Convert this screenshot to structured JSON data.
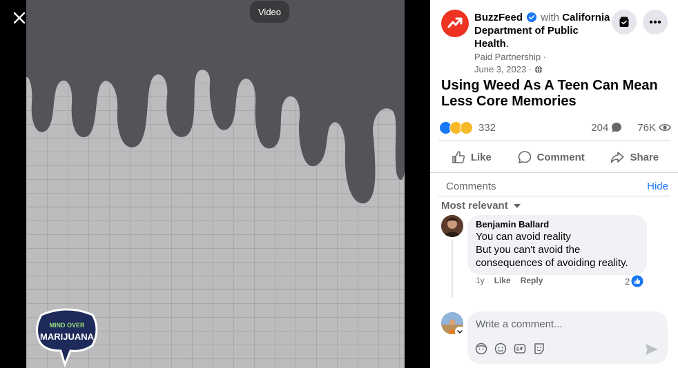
{
  "video": {
    "pill_label": "Video",
    "logo_line1": "MIND OVER",
    "logo_line2": "MARIJUANA"
  },
  "post": {
    "page_name": "BuzzFeed",
    "with_text": "with",
    "partner_name": "California Department of Public Health",
    "partner_suffix": ".",
    "partnership": "Paid Partnership ·",
    "date": "June 3, 2023 ·",
    "title": "Using Weed As A Teen Can Mean Less Core Memories",
    "reaction_count": "332",
    "comment_count": "204",
    "view_count": "76K"
  },
  "actions": {
    "like": "Like",
    "comment": "Comment",
    "share": "Share"
  },
  "comments": {
    "header": "Comments",
    "hide": "Hide",
    "sort": "Most relevant",
    "items": [
      {
        "author": "Benjamin Ballard",
        "line1": "You can avoid reality",
        "line2": "But you can't avoid the",
        "line3": "consequences of avoiding reality.",
        "age": "1y",
        "like": "Like",
        "reply": "Reply",
        "likes": "2"
      }
    ]
  },
  "composer": {
    "placeholder": "Write a comment..."
  },
  "colors": {
    "brand_blue": "#1877f2",
    "buzzfeed_red": "#ee3322",
    "panel_bg": "#ffffff",
    "bubble_bg": "#f0f2f5"
  }
}
